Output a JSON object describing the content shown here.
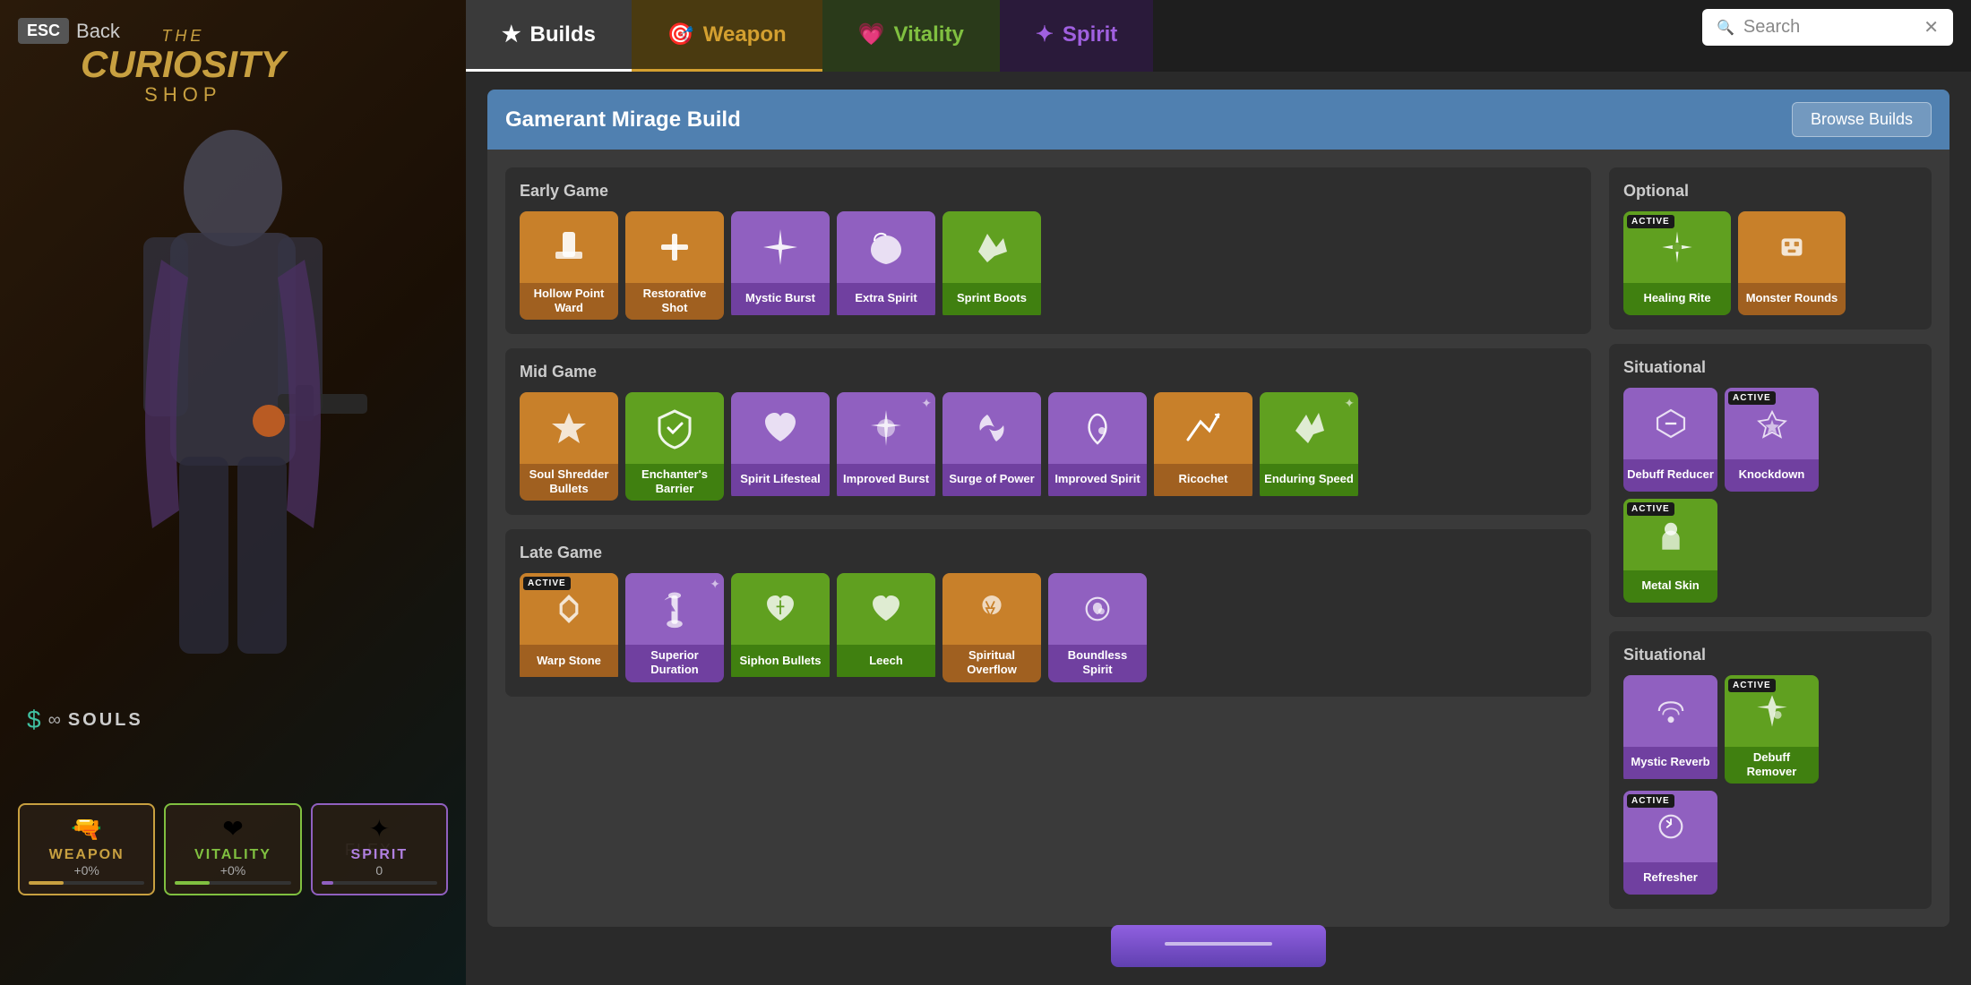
{
  "esc_back": {
    "esc_label": "ESC",
    "back_label": "Back"
  },
  "logo": {
    "the": "THE",
    "curiosity": "CURIOSITY",
    "shop": "SHOP"
  },
  "souls": {
    "label": "SOULS"
  },
  "flex_label": "FLEX",
  "stats": {
    "weapon": {
      "name": "WEAPON",
      "value": "+0%",
      "zero": ""
    },
    "vitality": {
      "name": "VITALITY",
      "value": "+0%",
      "zero": ""
    },
    "spirit": {
      "name": "SPIRIT",
      "value": "0",
      "zero": "0"
    }
  },
  "tabs": [
    {
      "id": "builds",
      "label": "Builds",
      "icon": "★"
    },
    {
      "id": "weapon",
      "label": "Weapon",
      "icon": "🎯"
    },
    {
      "id": "vitality",
      "label": "Vitality",
      "icon": "💗"
    },
    {
      "id": "spirit",
      "label": "Spirit",
      "icon": "✦"
    }
  ],
  "search": {
    "placeholder": "Search",
    "close_icon": "✕"
  },
  "build": {
    "title": "Gamerant Mirage Build",
    "browse_builds_label": "Browse Builds"
  },
  "sections": {
    "early_game": {
      "title": "Early Game",
      "items": [
        {
          "id": "hollow-point-ward",
          "label": "Hollow Point Ward",
          "color": "orange",
          "icon": "🔫",
          "active": false
        },
        {
          "id": "restorative-shot",
          "label": "Restorative Shot",
          "color": "orange",
          "icon": "✚",
          "active": false
        },
        {
          "id": "mystic-burst",
          "label": "Mystic Burst",
          "color": "purple",
          "icon": "✶",
          "active": false
        },
        {
          "id": "extra-spirit",
          "label": "Extra Spirit",
          "color": "purple",
          "icon": "❤",
          "active": false
        },
        {
          "id": "sprint-boots",
          "label": "Sprint Boots",
          "color": "green",
          "icon": "✂",
          "active": false
        }
      ]
    },
    "mid_game": {
      "title": "Mid Game",
      "items": [
        {
          "id": "soul-shredder-bullets",
          "label": "Soul Shredder Bullets",
          "color": "orange",
          "icon": "⬆",
          "active": false
        },
        {
          "id": "enchanters-barrier",
          "label": "Enchanter's Barrier",
          "color": "green",
          "icon": "🛡",
          "active": false
        },
        {
          "id": "spirit-lifesteal",
          "label": "Spirit Lifesteal",
          "color": "purple",
          "icon": "♥",
          "active": false
        },
        {
          "id": "improved-burst",
          "label": "Improved Burst",
          "color": "purple",
          "icon": "⚙",
          "active": false,
          "sparkle": true
        },
        {
          "id": "surge-of-power",
          "label": "Surge of Power",
          "color": "purple",
          "icon": "🌸",
          "active": false
        },
        {
          "id": "improved-spirit",
          "label": "Improved Spirit",
          "color": "purple",
          "icon": "🌀",
          "active": false
        },
        {
          "id": "ricochet",
          "label": "Ricochet",
          "color": "orange",
          "icon": "↗",
          "active": false
        },
        {
          "id": "enduring-speed",
          "label": "Enduring Speed",
          "color": "green",
          "icon": "⚡",
          "active": false,
          "sparkle": true
        }
      ]
    },
    "late_game": {
      "title": "Late Game",
      "items": [
        {
          "id": "warp-stone",
          "label": "Warp Stone",
          "color": "orange",
          "icon": "💎",
          "active": true
        },
        {
          "id": "superior-duration",
          "label": "Superior Duration",
          "color": "purple",
          "icon": "⏳",
          "active": false,
          "sparkle": true
        },
        {
          "id": "siphon-bullets",
          "label": "Siphon Bullets",
          "color": "green",
          "icon": "💚",
          "active": false
        },
        {
          "id": "leech",
          "label": "Leech",
          "color": "green",
          "icon": "🍃",
          "active": false
        },
        {
          "id": "spiritual-overflow",
          "label": "Spiritual Overflow",
          "color": "orange",
          "icon": "💀",
          "active": false
        },
        {
          "id": "boundless-spirit",
          "label": "Boundless Spirit",
          "color": "purple",
          "icon": "🔮",
          "active": false
        }
      ]
    },
    "optional": {
      "title": "Optional",
      "items": [
        {
          "id": "healing-rite",
          "label": "Healing Rite",
          "color": "green",
          "icon": "✦",
          "active": true
        },
        {
          "id": "monster-rounds",
          "label": "Monster Rounds",
          "color": "orange",
          "icon": "🤖",
          "active": false
        }
      ]
    },
    "situational1": {
      "title": "Situational",
      "items": [
        {
          "id": "debuff-reducer",
          "label": "Debuff Reducer",
          "color": "purple",
          "icon": "◈",
          "active": false
        },
        {
          "id": "knockdown",
          "label": "Knockdown",
          "color": "purple",
          "icon": "▼",
          "active": true
        },
        {
          "id": "metal-skin",
          "label": "Metal Skin",
          "color": "green",
          "icon": "👤",
          "active": true
        }
      ]
    },
    "situational2": {
      "title": "Situational",
      "items": [
        {
          "id": "mystic-reverb",
          "label": "Mystic Reverb",
          "color": "purple",
          "icon": "〜",
          "active": false
        },
        {
          "id": "debuff-remover",
          "label": "Debuff Remover",
          "color": "green",
          "icon": "✦",
          "active": true
        },
        {
          "id": "refresher",
          "label": "Refresher",
          "color": "purple",
          "icon": "⌚",
          "active": true
        }
      ]
    }
  },
  "bottom_button": "───────────────"
}
